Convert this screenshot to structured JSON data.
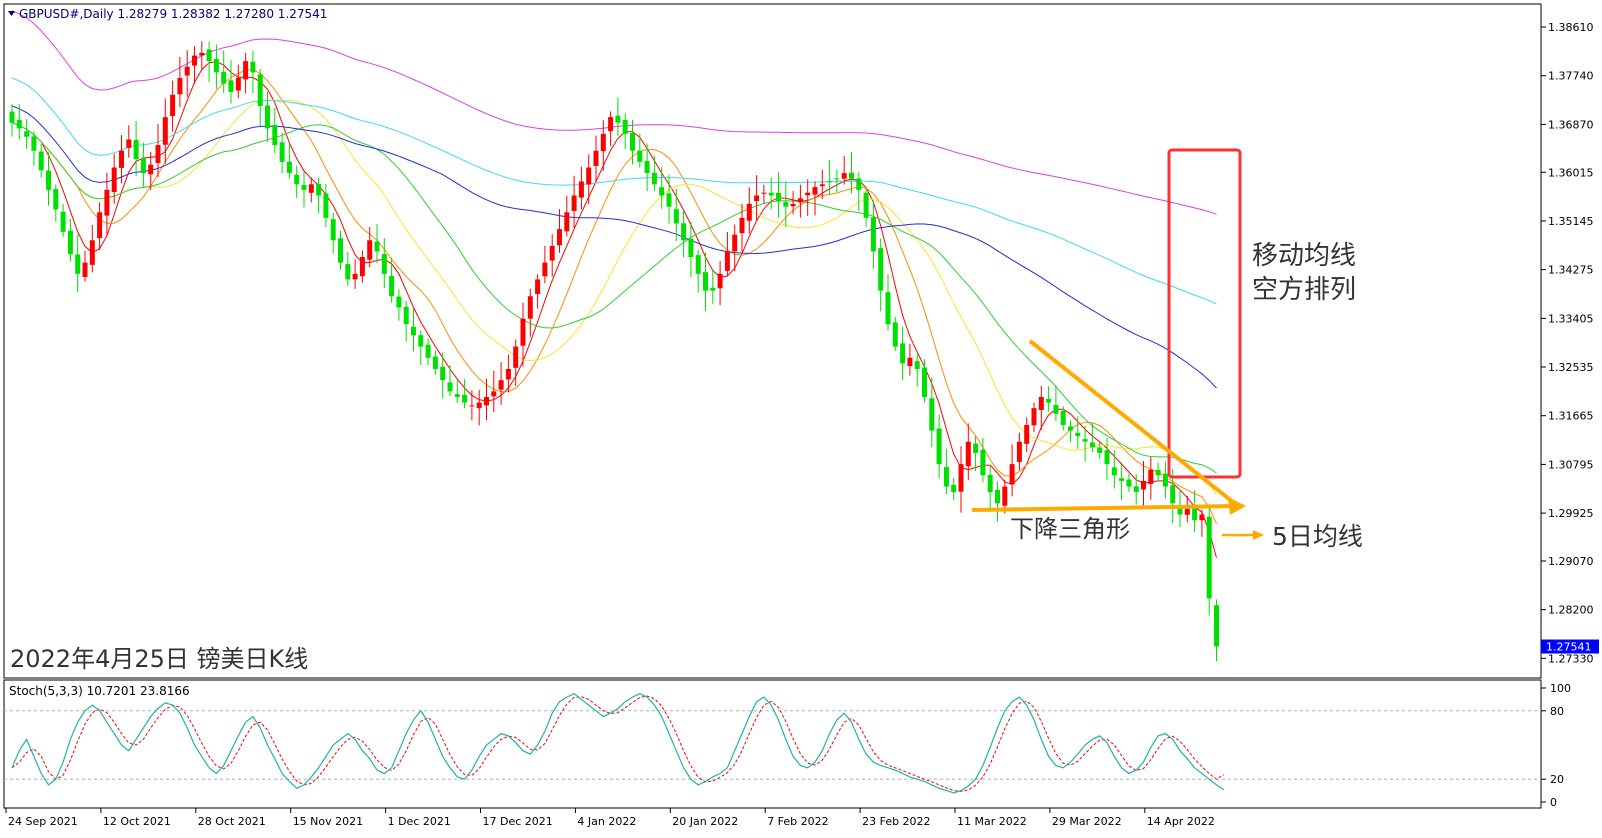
{
  "header": {
    "symbol_line": "GBPUSD#,Daily  1.28279 1.28382 1.27280 1.27541"
  },
  "subwindow": {
    "label": "Stoch(5,3,3) 10.7201 23.8166"
  },
  "annotations": {
    "date_title": "2022年4月25日 镑美日K线",
    "ma_bearish": [
      "移动均线",
      "空方排列"
    ],
    "triangle": "下降三角形",
    "ma5": "5日均线"
  },
  "colors": {
    "bull": "#ff0000",
    "bear": "#00e000",
    "ma5": "#ff0000",
    "ma10": "#ff8c00",
    "ma20": "#ffe030",
    "ma30": "#32cd32",
    "ma60": "#1f2fdc",
    "ma120": "#40d8f0",
    "ma250": "#e040e0",
    "annotation_orange": "#ffaa00",
    "annotation_red": "#ff3030",
    "price_tag": "#0000ff",
    "stoch_main": "#20b2aa",
    "stoch_signal": "#ff0000"
  },
  "chart_data": [
    {
      "type": "candlestick",
      "title": "GBPUSD#,Daily",
      "ohlc_last": {
        "open": 1.28279,
        "high": 1.28382,
        "low": 1.2728,
        "close": 1.27541
      },
      "y_ticks": [
        "1.38610",
        "1.37740",
        "1.36870",
        "1.36015",
        "1.35145",
        "1.34275",
        "1.33405",
        "1.32535",
        "1.31665",
        "1.30795",
        "1.29925",
        "1.29070",
        "1.28200",
        "1.27330"
      ],
      "current_price_tag": "1.27541",
      "ylim": [
        1.2705,
        1.3895
      ],
      "x_ticks": [
        "24 Sep 2021",
        "12 Oct 2021",
        "28 Oct 2021",
        "15 Nov 2021",
        "1 Dec 2021",
        "17 Dec 2021",
        "4 Jan 2022",
        "20 Jan 2022",
        "7 Feb 2022",
        "23 Feb 2022",
        "11 Mar 2022",
        "29 Mar 2022",
        "14 Apr 2022"
      ],
      "x_tick_bar_index": [
        0,
        13,
        26,
        39,
        52,
        65,
        78,
        91,
        104,
        117,
        130,
        143,
        156
      ],
      "candles_approx_close": [
        1.369,
        1.368,
        1.3665,
        1.364,
        1.3605,
        1.357,
        1.3535,
        1.3495,
        1.3455,
        1.342,
        1.344,
        1.348,
        1.353,
        1.357,
        1.361,
        1.364,
        1.366,
        1.3625,
        1.36,
        1.3615,
        1.365,
        1.37,
        1.374,
        1.377,
        1.379,
        1.381,
        1.3815,
        1.38,
        1.378,
        1.376,
        1.3745,
        1.377,
        1.38,
        1.378,
        1.372,
        1.368,
        1.365,
        1.362,
        1.36,
        1.358,
        1.357,
        1.358,
        1.356,
        1.352,
        1.348,
        1.344,
        1.341,
        1.342,
        1.345,
        1.348,
        1.346,
        1.342,
        1.338,
        1.336,
        1.333,
        1.331,
        1.329,
        1.327,
        1.325,
        1.323,
        1.321,
        1.32,
        1.319,
        1.3185,
        1.319,
        1.32,
        1.321,
        1.323,
        1.325,
        1.329,
        1.334,
        1.338,
        1.341,
        1.344,
        1.347,
        1.35,
        1.353,
        1.356,
        1.3585,
        1.361,
        1.364,
        1.367,
        1.37,
        1.369,
        1.367,
        1.364,
        1.362,
        1.36,
        1.358,
        1.356,
        1.354,
        1.351,
        1.348,
        1.345,
        1.342,
        1.339,
        1.339,
        1.342,
        1.346,
        1.349,
        1.352,
        1.3545,
        1.356,
        1.3565,
        1.356,
        1.355,
        1.354,
        1.3545,
        1.3555,
        1.3565,
        1.3575,
        1.358,
        1.3585,
        1.359,
        1.36,
        1.359,
        1.357,
        1.352,
        1.346,
        1.339,
        1.333,
        1.329,
        1.326,
        1.327,
        1.325,
        1.32,
        1.314,
        1.308,
        1.304,
        1.303,
        1.308,
        1.312,
        1.31,
        1.306,
        1.303,
        1.301,
        1.304,
        1.308,
        1.312,
        1.315,
        1.318,
        1.32,
        1.319,
        1.317,
        1.315,
        1.314,
        1.313,
        1.312,
        1.311,
        1.31,
        1.308,
        1.306,
        1.305,
        1.304,
        1.303,
        1.305,
        1.307,
        1.306,
        1.304,
        1.301,
        1.299,
        1.3,
        1.298,
        1.299,
        1.284,
        1.2754
      ],
      "moving_averages": [
        "MA5",
        "MA10",
        "MA20",
        "MA30",
        "MA60",
        "MA120",
        "MA250"
      ]
    },
    {
      "type": "line",
      "title": "Stoch(5,3,3)",
      "series": [
        {
          "name": "main",
          "last": 10.7201
        },
        {
          "name": "signal",
          "last": 23.8166
        }
      ],
      "ylim": [
        0,
        100
      ],
      "y_ticks": [
        "100",
        "80",
        "20",
        "0"
      ],
      "levels": [
        80,
        20
      ],
      "main_approx": [
        30,
        45,
        55,
        40,
        25,
        15,
        20,
        35,
        55,
        70,
        80,
        85,
        80,
        70,
        60,
        50,
        45,
        55,
        65,
        75,
        82,
        87,
        85,
        78,
        65,
        50,
        40,
        30,
        25,
        32,
        45,
        58,
        70,
        75,
        65,
        50,
        38,
        25,
        18,
        12,
        15,
        22,
        30,
        40,
        50,
        55,
        60,
        55,
        45,
        38,
        28,
        25,
        30,
        45,
        60,
        72,
        80,
        70,
        55,
        40,
        30,
        22,
        20,
        28,
        40,
        50,
        55,
        60,
        58,
        52,
        45,
        42,
        50,
        62,
        78,
        88,
        92,
        95,
        90,
        85,
        80,
        75,
        78,
        82,
        88,
        92,
        95,
        92,
        85,
        75,
        60,
        45,
        30,
        20,
        15,
        18,
        22,
        25,
        30,
        45,
        60,
        75,
        88,
        92,
        85,
        72,
        55,
        40,
        32,
        30,
        35,
        45,
        60,
        72,
        78,
        70,
        55,
        42,
        35,
        32,
        30,
        28,
        25,
        22,
        20,
        18,
        15,
        12,
        10,
        8,
        10,
        14,
        20,
        32,
        48,
        65,
        80,
        88,
        92,
        85,
        72,
        55,
        40,
        32,
        30,
        35,
        42,
        50,
        55,
        58,
        52,
        40,
        30,
        25,
        28,
        35,
        48,
        58,
        60,
        55,
        45,
        38,
        30,
        25,
        20,
        15,
        10.72
      ]
    }
  ]
}
